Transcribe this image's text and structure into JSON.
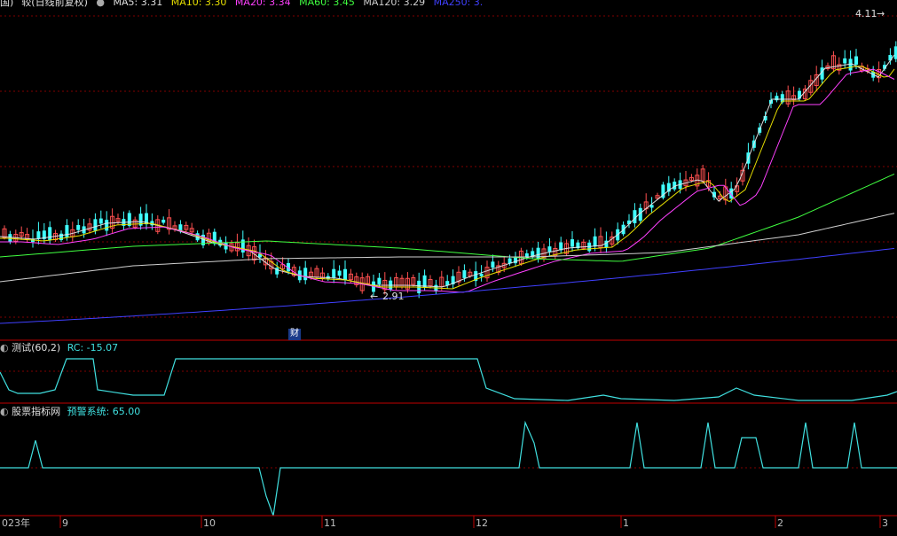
{
  "header": {
    "title": "国)  `较(日线前复权)",
    "ma_items": [
      {
        "label": "MA5: 3.31",
        "color": "#e0e0e0"
      },
      {
        "label": "MA10: 3.30",
        "color": "#e8e000"
      },
      {
        "label": "MA20: 3.34",
        "color": "#ff40ff"
      },
      {
        "label": "MA60: 3.45",
        "color": "#40ff40"
      },
      {
        "label": "MA120: 3.29",
        "color": "#d0d0d0"
      },
      {
        "label": "MA250: 3.",
        "color": "#4040ff"
      }
    ]
  },
  "main_panel": {
    "high_label": "4.11",
    "low_label": "2.91",
    "finance_marker": "财"
  },
  "indicator1": {
    "name": "测试(60,2)",
    "value_text": "RC: -15.07",
    "line_color": "#40e0e0"
  },
  "indicator2": {
    "name": "股票指标网",
    "value_text": "预警系统: 65.00",
    "line_color": "#40e0e0"
  },
  "time_axis": {
    "labels": [
      "023年",
      "9",
      "10",
      "11",
      "12",
      "1",
      "2",
      "3"
    ]
  },
  "colors": {
    "up": "#ff5050",
    "down": "#40ffff",
    "grid": "#800000",
    "separator": "#c00000"
  }
}
